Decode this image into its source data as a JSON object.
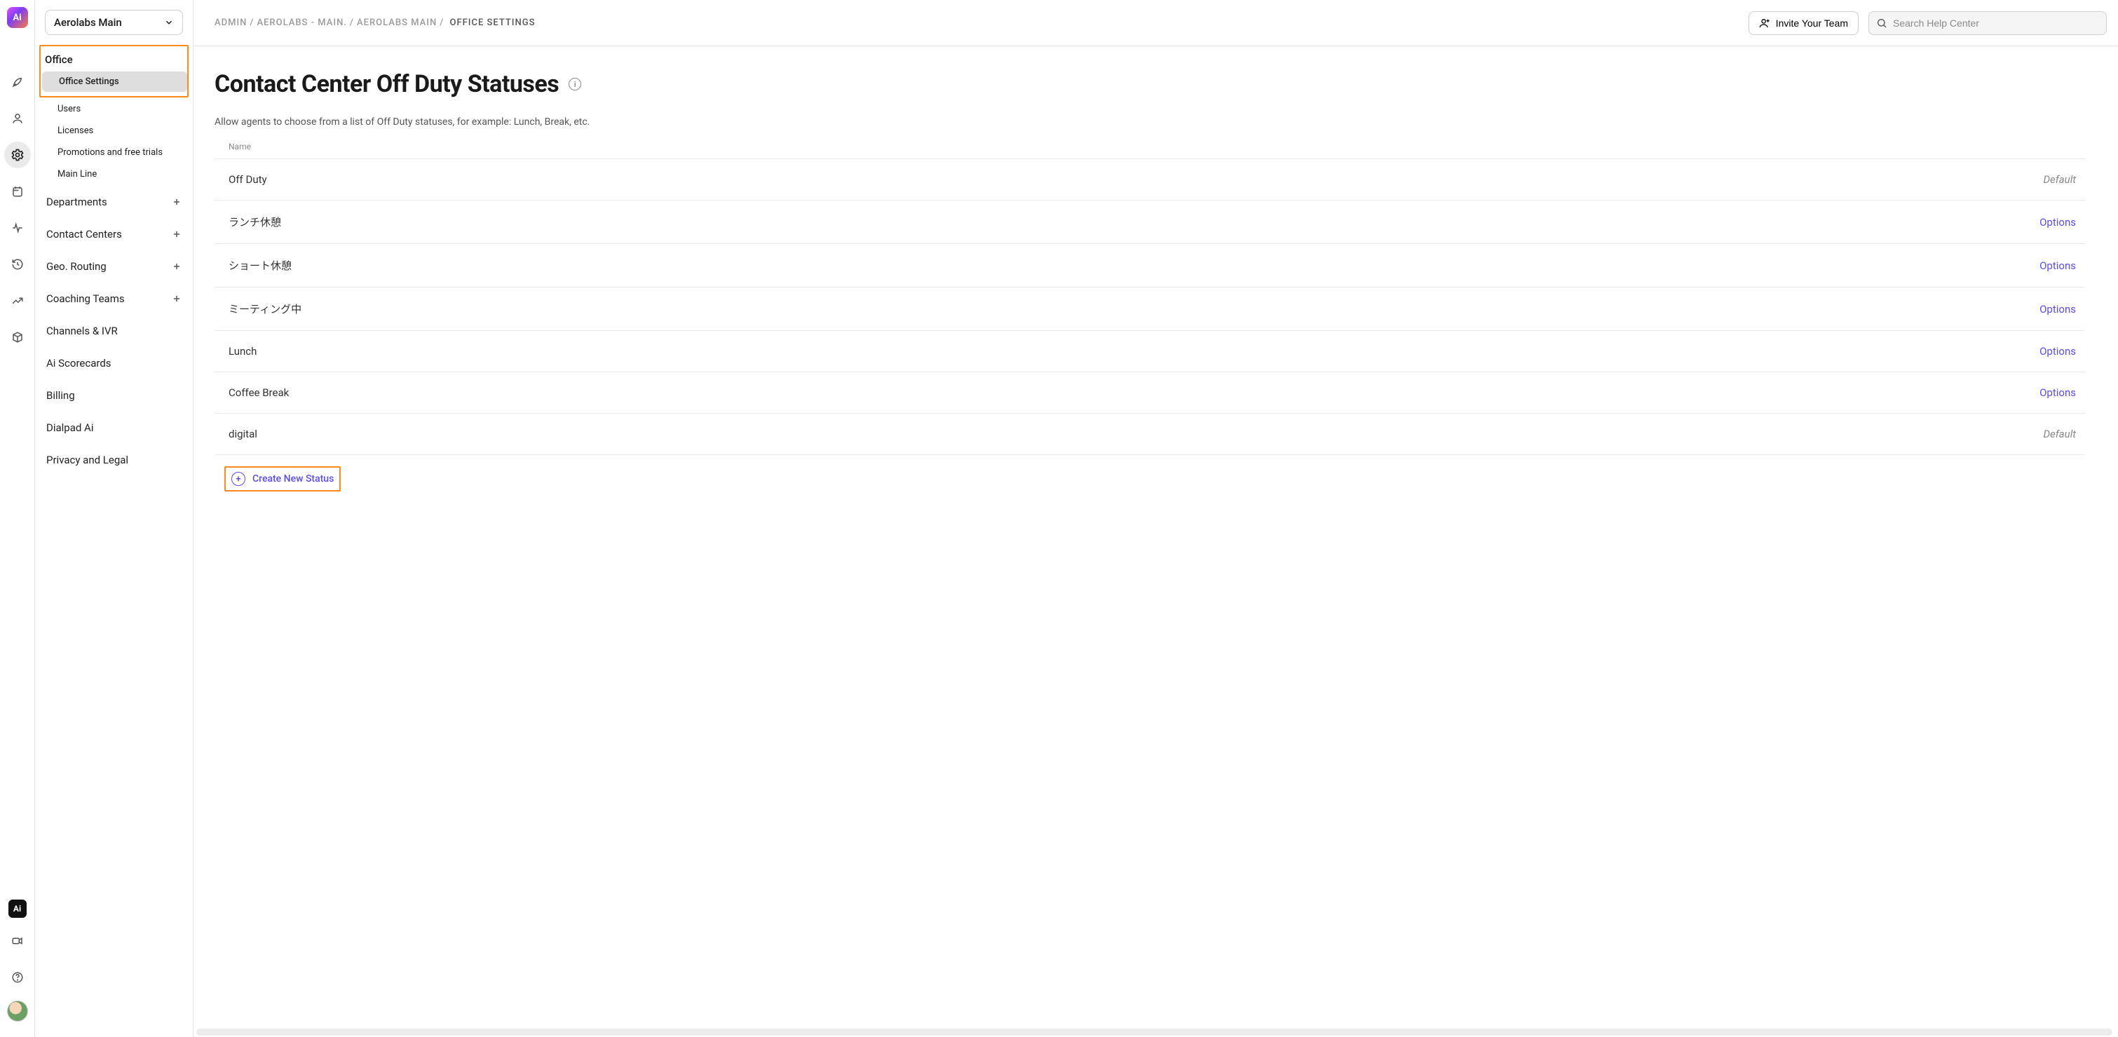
{
  "org_picker": {
    "label": "Aerolabs Main"
  },
  "breadcrumb": {
    "items": [
      "ADMIN",
      "AEROLABS - MAIN.",
      "AEROLABS MAIN"
    ],
    "current": "OFFICE SETTINGS"
  },
  "topbar": {
    "invite_label": "Invite Your Team",
    "search_placeholder": "Search Help Center"
  },
  "sidebar": {
    "office_group": {
      "title": "Office",
      "items": [
        {
          "label": "Office Settings",
          "active": true
        },
        {
          "label": "Users"
        },
        {
          "label": "Licenses"
        },
        {
          "label": "Promotions and free trials"
        },
        {
          "label": "Main Line"
        }
      ]
    },
    "nav": [
      {
        "label": "Departments",
        "expandable": true
      },
      {
        "label": "Contact Centers",
        "expandable": true
      },
      {
        "label": "Geo. Routing",
        "expandable": true
      },
      {
        "label": "Coaching Teams",
        "expandable": true
      },
      {
        "label": "Channels & IVR",
        "expandable": false
      },
      {
        "label": "Ai Scorecards",
        "expandable": false
      },
      {
        "label": "Billing",
        "expandable": false
      },
      {
        "label": "Dialpad Ai",
        "expandable": false
      },
      {
        "label": "Privacy and Legal",
        "expandable": false
      }
    ]
  },
  "page": {
    "title": "Contact Center Off Duty Statuses",
    "description": "Allow agents to choose from a list of Off Duty statuses, for example: Lunch, Break, etc.",
    "table_header": "Name",
    "default_label": "Default",
    "options_label": "Options",
    "create_label": "Create New Status",
    "rows": [
      {
        "name": "Off Duty",
        "action": "default"
      },
      {
        "name": "ランチ休憩",
        "action": "options"
      },
      {
        "name": "ショート休憩",
        "action": "options"
      },
      {
        "name": "ミーティング中",
        "action": "options"
      },
      {
        "name": "Lunch",
        "action": "options"
      },
      {
        "name": "Coffee Break",
        "action": "options"
      },
      {
        "name": "digital",
        "action": "default"
      }
    ]
  }
}
